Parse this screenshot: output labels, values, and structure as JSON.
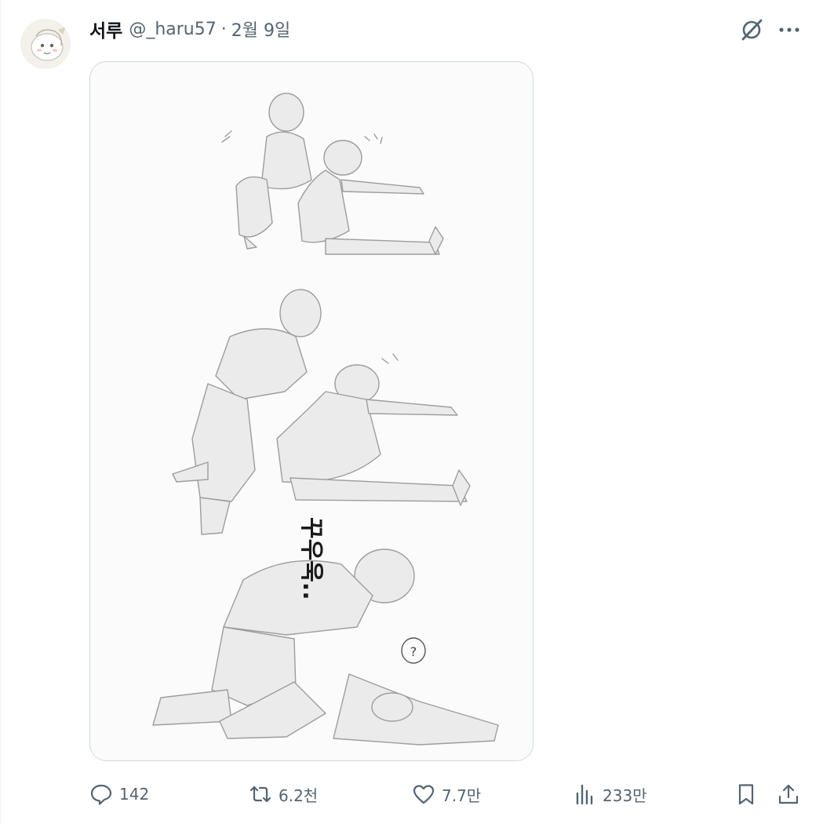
{
  "tweet": {
    "author_name": "서루",
    "handle": "@_haru57",
    "separator": "·",
    "date": "2월 9일",
    "media_text": {
      "sfx": "꾸우욱..",
      "question": "?"
    },
    "actions": {
      "replies": "142",
      "retweets": "6.2천",
      "likes": "7.7만",
      "views": "233만"
    }
  },
  "icons": {
    "grok": "grok-icon",
    "more": "more-icon",
    "reply": "reply-icon",
    "retweet": "retweet-icon",
    "like": "heart-icon",
    "views": "views-icon",
    "bookmark": "bookmark-icon",
    "share": "share-icon"
  },
  "colors": {
    "text_primary": "#0f1419",
    "text_secondary": "#536471",
    "border": "#cfd9de"
  }
}
